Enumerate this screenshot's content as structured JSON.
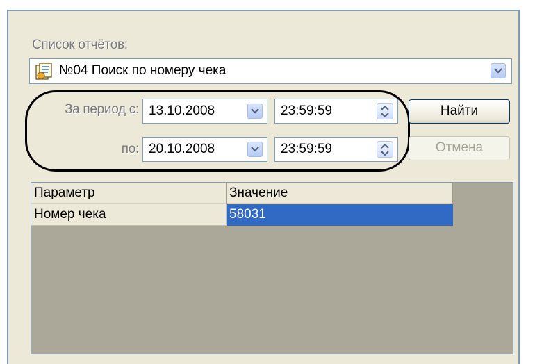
{
  "reports": {
    "label": "Список отчётов:",
    "selected": "№04 Поиск по номеру чека",
    "icon": "report-document-icon"
  },
  "period": {
    "from_label": "За период с:",
    "to_label": "по:",
    "from_date": "13.10.2008",
    "from_time": "23:59:59",
    "to_date": "20.10.2008",
    "to_time": "23:59:59"
  },
  "buttons": {
    "find": "Найти",
    "cancel": "Отмена"
  },
  "table": {
    "columns": [
      "Параметр",
      "Значение"
    ],
    "rows": [
      {
        "param": "Номер чека",
        "value": "58031"
      }
    ]
  },
  "colors": {
    "selection": "#316ac5",
    "panel": "#ece9d8",
    "border": "#7f9db9"
  }
}
